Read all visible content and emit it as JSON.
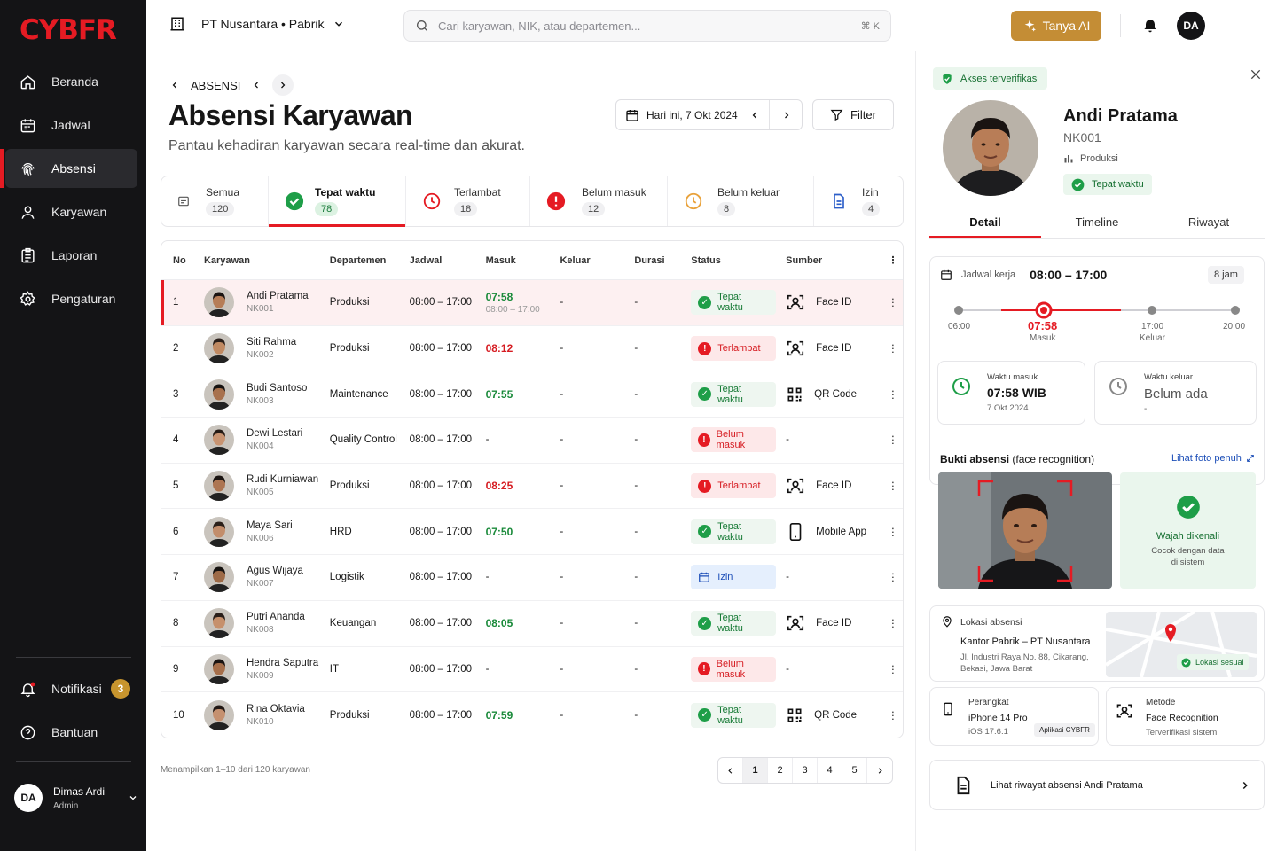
{
  "brand": {
    "logo": "CYBFR"
  },
  "sidebar": {
    "items": [
      {
        "label": "Beranda",
        "icon": "home-icon"
      },
      {
        "label": "Jadwal",
        "icon": "calendar-icon"
      },
      {
        "label": "Absensi",
        "icon": "fingerprint-icon",
        "active": true
      },
      {
        "label": "Karyawan",
        "icon": "user-icon"
      },
      {
        "label": "Laporan",
        "icon": "report-icon"
      },
      {
        "label": "Pengaturan",
        "icon": "gear-icon"
      }
    ],
    "notif_label": "Notifikasi",
    "notif_count": "3",
    "help_label": "Bantuan",
    "user": {
      "initials": "DA",
      "name": "Dimas Ardi",
      "role": "Admin"
    }
  },
  "topbar": {
    "company": "PT Nusantara • Pabrik",
    "search_placeholder": "Cari karyawan, NIK, atau departemen...",
    "shortcut": "⌘ K",
    "ai_label": "Tanya AI",
    "avatar": "DA"
  },
  "page": {
    "crumb": "ABSENSI",
    "title": "Absensi Karyawan",
    "subtitle": "Pantau kehadiran karyawan secara real-time dan akurat.",
    "date_label": "Hari ini, 7 Okt 2024",
    "filter_label": "Filter"
  },
  "tabs": [
    {
      "label": "Semua",
      "count": "120"
    },
    {
      "label": "Tepat waktu",
      "count": "78",
      "active": true
    },
    {
      "label": "Terlambat",
      "count": "18"
    },
    {
      "label": "Belum masuk",
      "count": "12"
    },
    {
      "label": "Belum keluar",
      "count": "8"
    },
    {
      "label": "Izin",
      "count": "4"
    }
  ],
  "table": {
    "headers": [
      "No",
      "Karyawan",
      "Departemen",
      "Jadwal",
      "Masuk",
      "Keluar",
      "Durasi",
      "Status",
      "Sumber"
    ],
    "rows": [
      {
        "no": "1",
        "name": "Andi Pratama",
        "nik": "NK001",
        "dept": "Produksi",
        "sched": "08:00 – 17:00",
        "in": "07:58",
        "in_sub": "08:00 – 17:00",
        "out": "-",
        "dur": "-",
        "status": "Tepat waktu",
        "stype": "ok",
        "src": "Face ID",
        "srctype": "face"
      },
      {
        "no": "2",
        "name": "Siti Rahma",
        "nik": "NK002",
        "dept": "Produksi",
        "sched": "08:00 – 17:00",
        "in": "08:12",
        "in_sub": "",
        "out": "-",
        "dur": "-",
        "status": "Terlambat",
        "stype": "late",
        "src": "Face ID",
        "srctype": "face"
      },
      {
        "no": "3",
        "name": "Budi Santoso",
        "nik": "NK003",
        "dept": "Maintenance",
        "sched": "08:00 – 17:00",
        "in": "07:55",
        "in_sub": "",
        "out": "-",
        "dur": "-",
        "status": "Tepat waktu",
        "stype": "ok",
        "src": "QR Code",
        "srctype": "qr"
      },
      {
        "no": "4",
        "name": "Dewi Lestari",
        "nik": "NK004",
        "dept": "Quality Control",
        "sched": "08:00 – 17:00",
        "in": "-",
        "in_sub": "",
        "out": "-",
        "dur": "-",
        "status": "Belum masuk",
        "stype": "absent",
        "src": "-",
        "srctype": "none"
      },
      {
        "no": "5",
        "name": "Rudi Kurniawan",
        "nik": "NK005",
        "dept": "Produksi",
        "sched": "08:00 – 17:00",
        "in": "08:25",
        "in_sub": "",
        "out": "-",
        "dur": "-",
        "status": "Terlambat",
        "stype": "late",
        "src": "Face ID",
        "srctype": "face"
      },
      {
        "no": "6",
        "name": "Maya Sari",
        "nik": "NK006",
        "dept": "HRD",
        "sched": "08:00 – 17:00",
        "in": "07:50",
        "in_sub": "",
        "out": "-",
        "dur": "-",
        "status": "Tepat waktu",
        "stype": "ok",
        "src": "Mobile App",
        "srctype": "mobile"
      },
      {
        "no": "7",
        "name": "Agus Wijaya",
        "nik": "NK007",
        "dept": "Logistik",
        "sched": "08:00 – 17:00",
        "in": "-",
        "in_sub": "",
        "out": "-",
        "dur": "-",
        "status": "Izin",
        "stype": "leave",
        "src": "-",
        "srctype": "none"
      },
      {
        "no": "8",
        "name": "Putri Ananda",
        "nik": "NK008",
        "dept": "Keuangan",
        "sched": "08:00 – 17:00",
        "in": "08:05",
        "in_sub": "",
        "out": "-",
        "dur": "-",
        "status": "Tepat waktu",
        "stype": "ok",
        "src": "Face ID",
        "srctype": "face"
      },
      {
        "no": "9",
        "name": "Hendra Saputra",
        "nik": "NK009",
        "dept": "IT",
        "sched": "08:00 – 17:00",
        "in": "-",
        "in_sub": "",
        "out": "-",
        "dur": "-",
        "status": "Belum masuk",
        "stype": "absent",
        "src": "-",
        "srctype": "none"
      },
      {
        "no": "10",
        "name": "Rina Oktavia",
        "nik": "NK010",
        "dept": "Produksi",
        "sched": "08:00 – 17:00",
        "in": "07:59",
        "in_sub": "",
        "out": "-",
        "dur": "-",
        "status": "Tepat waktu",
        "stype": "ok",
        "src": "QR Code",
        "srctype": "qr"
      }
    ],
    "footer": "Menampilkan 1–10 dari 120 karyawan",
    "pages": [
      "1",
      "2",
      "3",
      "4",
      "5"
    ]
  },
  "panel": {
    "verified": "Akses terverifikasi",
    "name": "Andi Pratama",
    "nik": "NK001",
    "dept": "Produksi",
    "status": "Tepat waktu",
    "tabs": [
      "Detail",
      "Timeline",
      "Riwayat"
    ],
    "schedule_label": "Jadwal kerja",
    "schedule": "08:00 – 17:00",
    "hours": "8 jam",
    "timeline": {
      "t_start": "06:00",
      "t_in": "07:58",
      "t_in_label": "Masuk",
      "t_out": "17:00",
      "t_out_label": "Keluar",
      "t_end": "20:00"
    },
    "in_label": "Waktu masuk",
    "in_time": "07:58 WIB",
    "in_date": "7 Okt 2024",
    "out_label": "Waktu keluar",
    "out_value": "Belum ada",
    "out_sub": "-",
    "proof_title": "Bukti absensi",
    "proof_sub": "(face recognition)",
    "proof_link": "Lihat foto penuh",
    "face_ok": "Wajah dikenali",
    "face_desc1": "Cocok dengan data",
    "face_desc2": "di sistem",
    "loc_label": "Lokasi absensi",
    "loc_name": "Kantor Pabrik – PT Nusantara",
    "loc_addr1": "Jl. Industri Raya No. 88, Cikarang,",
    "loc_addr2": "Bekasi, Jawa Barat",
    "loc_ok": "Lokasi sesuai",
    "dev_label": "Perangkat",
    "dev_name": "iPhone 14 Pro",
    "dev_os": "iOS 17.6.1",
    "dev_app": "Aplikasi CYBFR",
    "method_label": "Metode",
    "method_name": "Face Recognition",
    "method_sub": "Terverifikasi sistem",
    "history_link": "Lihat riwayat absensi Andi Pratama"
  },
  "colors": {
    "brand_red": "#e51b23",
    "gold": "#c48d35",
    "green": "#1e9e48",
    "sidebar": "#141416"
  }
}
